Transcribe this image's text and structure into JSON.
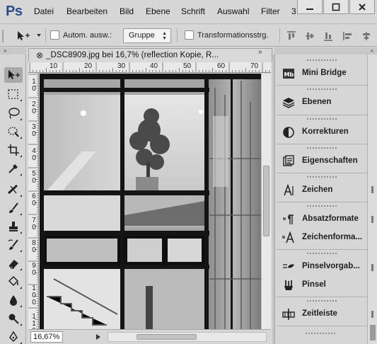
{
  "app": {
    "logo": "Ps"
  },
  "menu": [
    "Datei",
    "Bearbeiten",
    "Bild",
    "Ebene",
    "Schrift",
    "Auswahl",
    "Filter",
    "3"
  ],
  "window_controls": [
    "minimize-icon",
    "maximize-icon",
    "close-icon"
  ],
  "options_bar": {
    "auto_select_label": "Autom. ausw.:",
    "auto_select_checked": false,
    "group_select_value": "Gruppe",
    "transform_controls_label": "Transformationsstrg.",
    "transform_controls_checked": false
  },
  "document": {
    "tab_close": "⊗",
    "tab_title": "_DSC8909.jpg bei 16,7% (reflection Kopie, R...",
    "tab_arrows": "»",
    "zoom": "16,67%",
    "ruler_top_labels": [
      "10",
      "20",
      "30",
      "40",
      "50",
      "60",
      "70"
    ],
    "ruler_left_labels": [
      "1\n0",
      "2\n0",
      "3\n0",
      "4\n0",
      "5\n0",
      "6\n0",
      "7\n0",
      "8\n0",
      "9\n0",
      "1\n0\n0",
      "1\n1\n0"
    ]
  },
  "tools": [
    "move-tool-icon",
    "marquee-tool-icon",
    "lasso-tool-icon",
    "quick-selection-tool-icon",
    "crop-tool-icon",
    "eyedropper-tool-icon",
    "healing-brush-tool-icon",
    "brush-tool-icon",
    "clone-stamp-tool-icon",
    "history-brush-tool-icon",
    "eraser-tool-icon",
    "paint-bucket-tool-icon",
    "blur-tool-icon",
    "dodge-tool-icon",
    "pen-tool-icon"
  ],
  "panels": {
    "mini_bridge": "Mini Bridge",
    "layers": "Ebenen",
    "adjustments": "Korrekturen",
    "properties": "Eigenschaften",
    "character": "Zeichen",
    "paragraph_styles": "Absatzformate",
    "character_styles": "Zeichenforma...",
    "brush_presets": "Pinselvorgab...",
    "brush": "Pinsel",
    "timeline": "Zeitleiste"
  },
  "colors": {
    "chrome": "#d6d6d6",
    "ps_logo": "#2b4d8c"
  }
}
